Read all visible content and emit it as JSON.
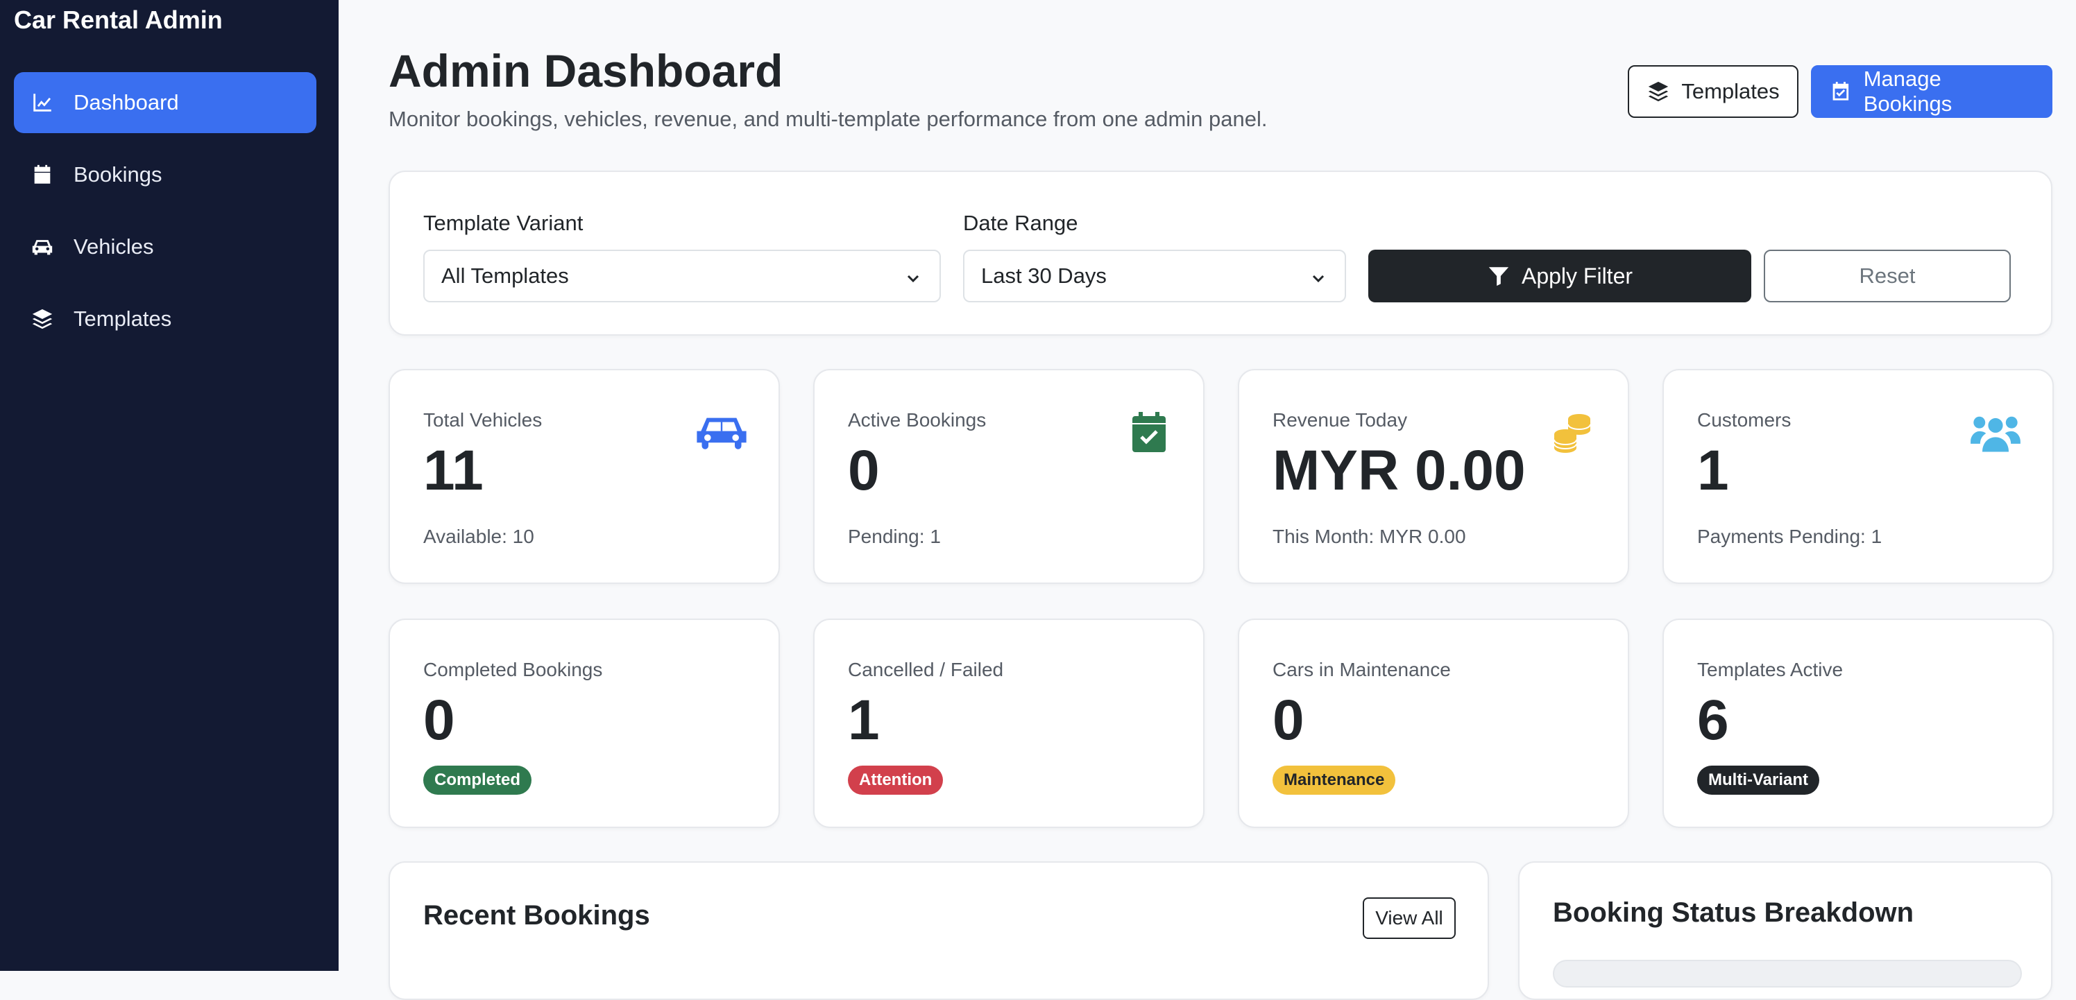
{
  "sidebar": {
    "brand": "Car Rental Admin",
    "items": [
      {
        "label": "Dashboard",
        "icon": "chart-line-icon",
        "active": true
      },
      {
        "label": "Bookings",
        "icon": "calendar-icon",
        "active": false
      },
      {
        "label": "Vehicles",
        "icon": "car-icon",
        "active": false
      },
      {
        "label": "Templates",
        "icon": "layers-icon",
        "active": false
      }
    ]
  },
  "header": {
    "title": "Admin Dashboard",
    "subtitle": "Monitor bookings, vehicles, revenue, and multi-template performance from one admin panel.",
    "templates_button": "Templates",
    "manage_bookings_button": "Manage Bookings"
  },
  "filters": {
    "template_variant_label": "Template Variant",
    "template_variant_value": "All Templates",
    "date_range_label": "Date Range",
    "date_range_value": "Last 30 Days",
    "apply_button": "Apply Filter",
    "reset_button": "Reset"
  },
  "stats": [
    {
      "label": "Total Vehicles",
      "value": "11",
      "sub": "Available: 10",
      "icon": "car-icon",
      "icon_color": "#3a6ff0"
    },
    {
      "label": "Active Bookings",
      "value": "0",
      "sub": "Pending: 1",
      "icon": "calendar-check-icon",
      "icon_color": "#2f7a4f"
    },
    {
      "label": "Revenue Today",
      "value": "MYR 0.00",
      "sub": "This Month: MYR 0.00",
      "icon": "coins-icon",
      "icon_color": "#f2c13c"
    },
    {
      "label": "Customers",
      "value": "1",
      "sub": "Payments Pending: 1",
      "icon": "users-icon",
      "icon_color": "#4fb6e6"
    }
  ],
  "stats2": [
    {
      "label": "Completed Bookings",
      "value": "0",
      "badge": "Completed",
      "badge_color": "#2f7a4f"
    },
    {
      "label": "Cancelled / Failed",
      "value": "1",
      "badge": "Attention",
      "badge_color": "#d2404c"
    },
    {
      "label": "Cars in Maintenance",
      "value": "0",
      "badge": "Maintenance",
      "badge_color": "#f2c13c"
    },
    {
      "label": "Templates Active",
      "value": "6",
      "badge": "Multi-Variant",
      "badge_color": "#212529"
    }
  ],
  "recent_bookings": {
    "title": "Recent Bookings",
    "view_all": "View All"
  },
  "status_breakdown": {
    "title": "Booking Status Breakdown"
  },
  "colors": {
    "sidebar_bg": "#131a33",
    "accent": "#3a6ff0"
  }
}
